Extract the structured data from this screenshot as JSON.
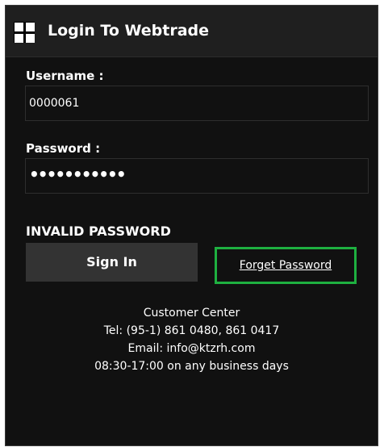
{
  "header": {
    "title": "Login To Webtrade",
    "icon": "windows-grid-icon"
  },
  "form": {
    "username_label": "Username :",
    "username_value": "0000061",
    "password_label": "Password :",
    "password_value": "•••••••••••",
    "error_message": "INVALID PASSWORD",
    "signin_label": "Sign In",
    "forget_label": "Forget Password"
  },
  "contact": {
    "title": "Customer Center",
    "tel": "Tel: (95-1) 861 0480, 861 0417",
    "email": "Email: info@ktzrh.com",
    "hours": "08:30-17:00 on any business days"
  },
  "colors": {
    "background": "#111111",
    "titlebar": "#1f1f1f",
    "button": "#333333",
    "highlight": "#1eb040"
  }
}
